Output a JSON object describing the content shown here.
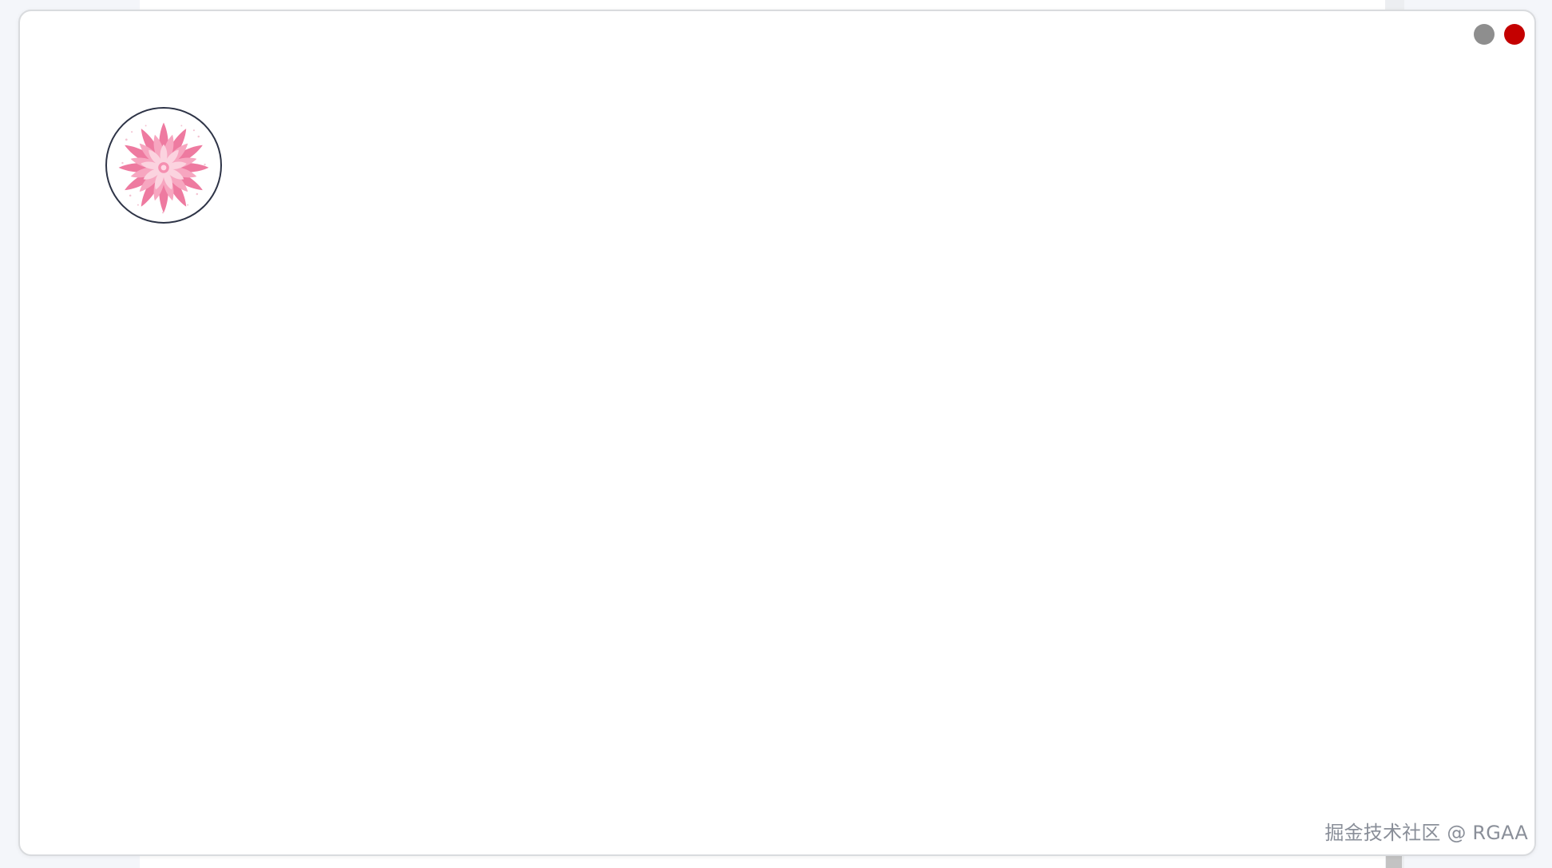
{
  "window": {
    "controls": [
      {
        "name": "minimize-button",
        "color": "#8e8e8e"
      },
      {
        "name": "close-button",
        "color": "#c40000"
      }
    ]
  },
  "avatar": {
    "icon": "lotus-flower-icon",
    "border_color": "#2e3447",
    "petal_colors": [
      "#f7a6c0",
      "#ef6f99",
      "#fbd3df"
    ]
  },
  "watermark": {
    "text": "掘金技术社区 @ RGAA"
  }
}
